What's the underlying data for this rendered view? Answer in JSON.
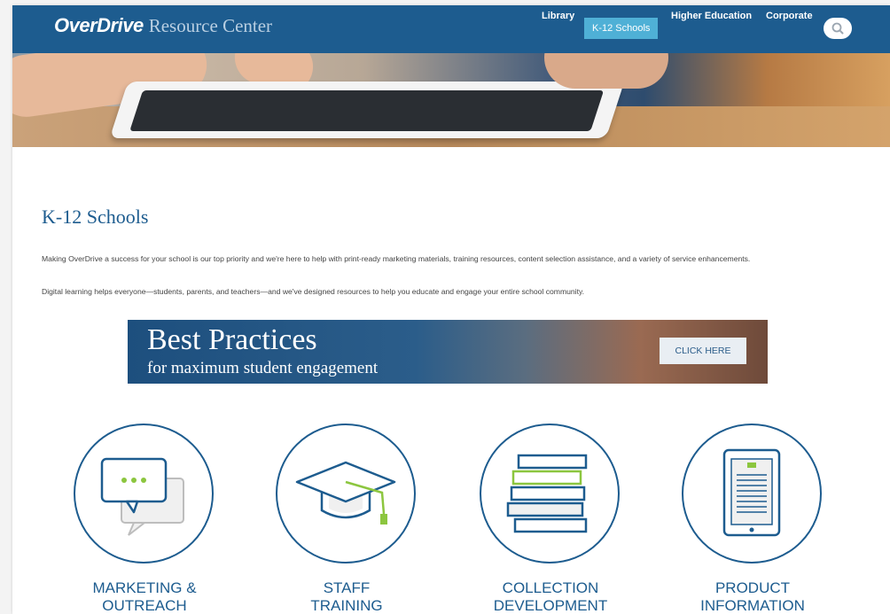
{
  "header": {
    "logo": "OverDrive",
    "subtitle": "Resource Center",
    "nav": [
      {
        "label": "Library",
        "active": false
      },
      {
        "label": "K-12 Schools",
        "active": true
      },
      {
        "label": "Higher Education",
        "active": false
      },
      {
        "label": "Corporate",
        "active": false
      }
    ],
    "search_icon": "search-icon"
  },
  "main": {
    "title": "K-12 Schools",
    "intro_1": "Making OverDrive a success for your school is our top priority and we're here to help with print-ready marketing materials, training resources, content selection assistance, and a variety of service enhancements.",
    "intro_2": "Digital learning helps everyone—students, parents, and teachers—and we've designed resources to help you educate and engage your entire school community.",
    "banner": {
      "headline": "Best Practices",
      "subline": "for maximum student engagement",
      "cta": "CLICK HERE"
    },
    "resources": [
      {
        "line1": "MARKETING &",
        "line2": "OUTREACH",
        "icon": "chat-bubbles-icon"
      },
      {
        "line1": "STAFF",
        "line2": "TRAINING",
        "icon": "graduation-cap-icon"
      },
      {
        "line1": "COLLECTION",
        "line2": "DEVELOPMENT",
        "icon": "book-stack-icon"
      },
      {
        "line1": "PRODUCT",
        "line2": "INFORMATION",
        "icon": "ereader-icon"
      }
    ]
  },
  "colors": {
    "brand_blue": "#1d5c8f",
    "active_tab": "#4fb0d6",
    "accent_green": "#8cc63f"
  }
}
